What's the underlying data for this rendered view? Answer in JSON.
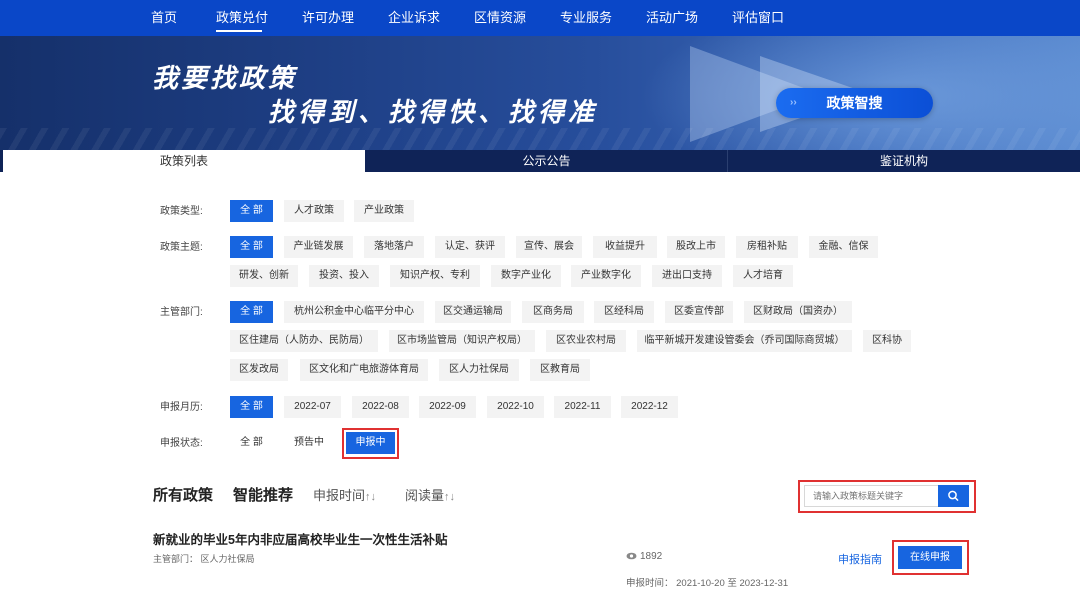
{
  "nav": {
    "items": [
      "首页",
      "政策兑付",
      "许可办理",
      "企业诉求",
      "区情资源",
      "专业服务",
      "活动广场",
      "评估窗口"
    ],
    "active_index": 1
  },
  "banner": {
    "line1": "我要找政策",
    "line2": "找得到、找得快、找得准",
    "button_label": "政策智搜"
  },
  "tabs": {
    "items": [
      "政策列表",
      "公示公告",
      "鉴证机构"
    ],
    "active_index": 0
  },
  "filters": {
    "type": {
      "label": "政策类型:",
      "options": [
        "全 部",
        "人才政策",
        "产业政策"
      ]
    },
    "theme": {
      "label": "政策主题:",
      "options": [
        "全 部",
        "产业链发展",
        "落地落户",
        "认定、获评",
        "宣传、展会",
        "收益提升",
        "股改上市",
        "房租补贴",
        "金融、信保",
        "研发、创新",
        "投资、投入",
        "知识产权、专利",
        "数字产业化",
        "产业数字化",
        "进出口支持",
        "人才培育"
      ]
    },
    "dept": {
      "label": "主管部门:",
      "options": [
        "全 部",
        "杭州公积金中心临平分中心",
        "区交通运输局",
        "区商务局",
        "区经科局",
        "区委宣传部",
        "区财政局（国资办）",
        "区住建局（人防办、民防局）",
        "区市场监管局（知识产权局）",
        "区农业农村局",
        "临平新城开发建设管委会（乔司国际商贸城）",
        "区科协",
        "区发改局",
        "区文化和广电旅游体育局",
        "区人力社保局",
        "区教育局"
      ]
    },
    "month": {
      "label": "申报月历:",
      "options": [
        "全 部",
        "2022-07",
        "2022-08",
        "2022-09",
        "2022-10",
        "2022-11",
        "2022-12"
      ]
    },
    "status": {
      "label": "申报状态:",
      "options": [
        "全 部",
        "预告中",
        "申报中"
      ],
      "active_index": 2
    }
  },
  "sort": {
    "all": "所有政策",
    "smart": "智能推荐",
    "by_time": "申报时间",
    "by_views": "阅读量",
    "arrows": "↑↓"
  },
  "search": {
    "placeholder": "请输入政策标题关键字",
    "icon": "search-icon"
  },
  "policy": {
    "title": "新就业的毕业5年内非应届高校毕业生一次性生活补贴",
    "dept": "主管部门：  区人力社保局",
    "views": "1892",
    "date": "申报时间：  2021-10-20 至 2023-12-31",
    "guide_label": "申报指南",
    "apply_label": "在线申报"
  },
  "colors": {
    "nav_bg": "#0a47c8",
    "accent": "#1765e0",
    "highlight": "#e03131",
    "tabs_bg": "#0f2357"
  }
}
